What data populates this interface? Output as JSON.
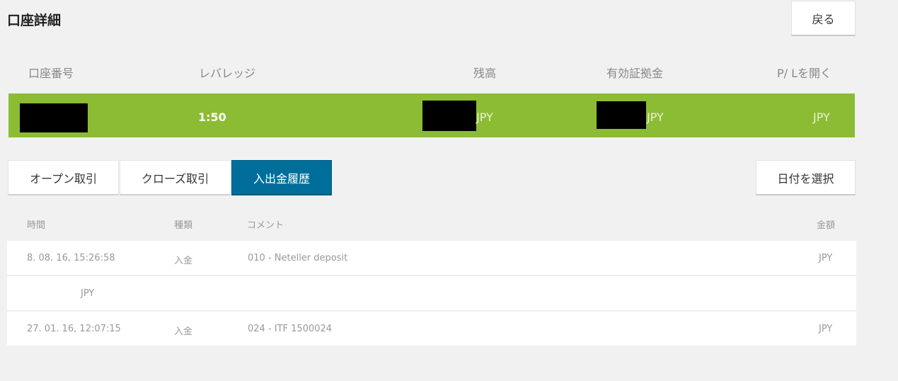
{
  "page": {
    "title": "口座詳細",
    "back_label": "戻る"
  },
  "account_headers": [
    "口座番号",
    "レバレッジ",
    "残高",
    "有効証拠金",
    "P/ Lを開く"
  ],
  "account": {
    "leverage": "1:50",
    "balance_currency": "JPY",
    "equity_currency": "JPY",
    "pl_currency": "JPY"
  },
  "colors": {
    "accent_green": "#8cbc33",
    "active_tab": "#006e9a"
  },
  "tabs": [
    {
      "label": "オープン取引",
      "active": false
    },
    {
      "label": "クローズ取引",
      "active": false
    },
    {
      "label": "入出金履歴",
      "active": true
    }
  ],
  "date_button_label": "日付を選択",
  "table": {
    "headers": {
      "time": "時間",
      "type": "種類",
      "comment": "コメント",
      "amount": "金額"
    },
    "rows": [
      {
        "time": "8. 08. 16, 15:26:58",
        "type": "入金",
        "comment": "010 - Neteller deposit",
        "amount": "JPY"
      },
      {
        "time": "JPY",
        "type": "",
        "comment": "",
        "amount": ""
      },
      {
        "time": "27. 01. 16, 12:07:15",
        "type": "入金",
        "comment": "024 - ITF 1500024",
        "amount": "JPY"
      }
    ]
  }
}
